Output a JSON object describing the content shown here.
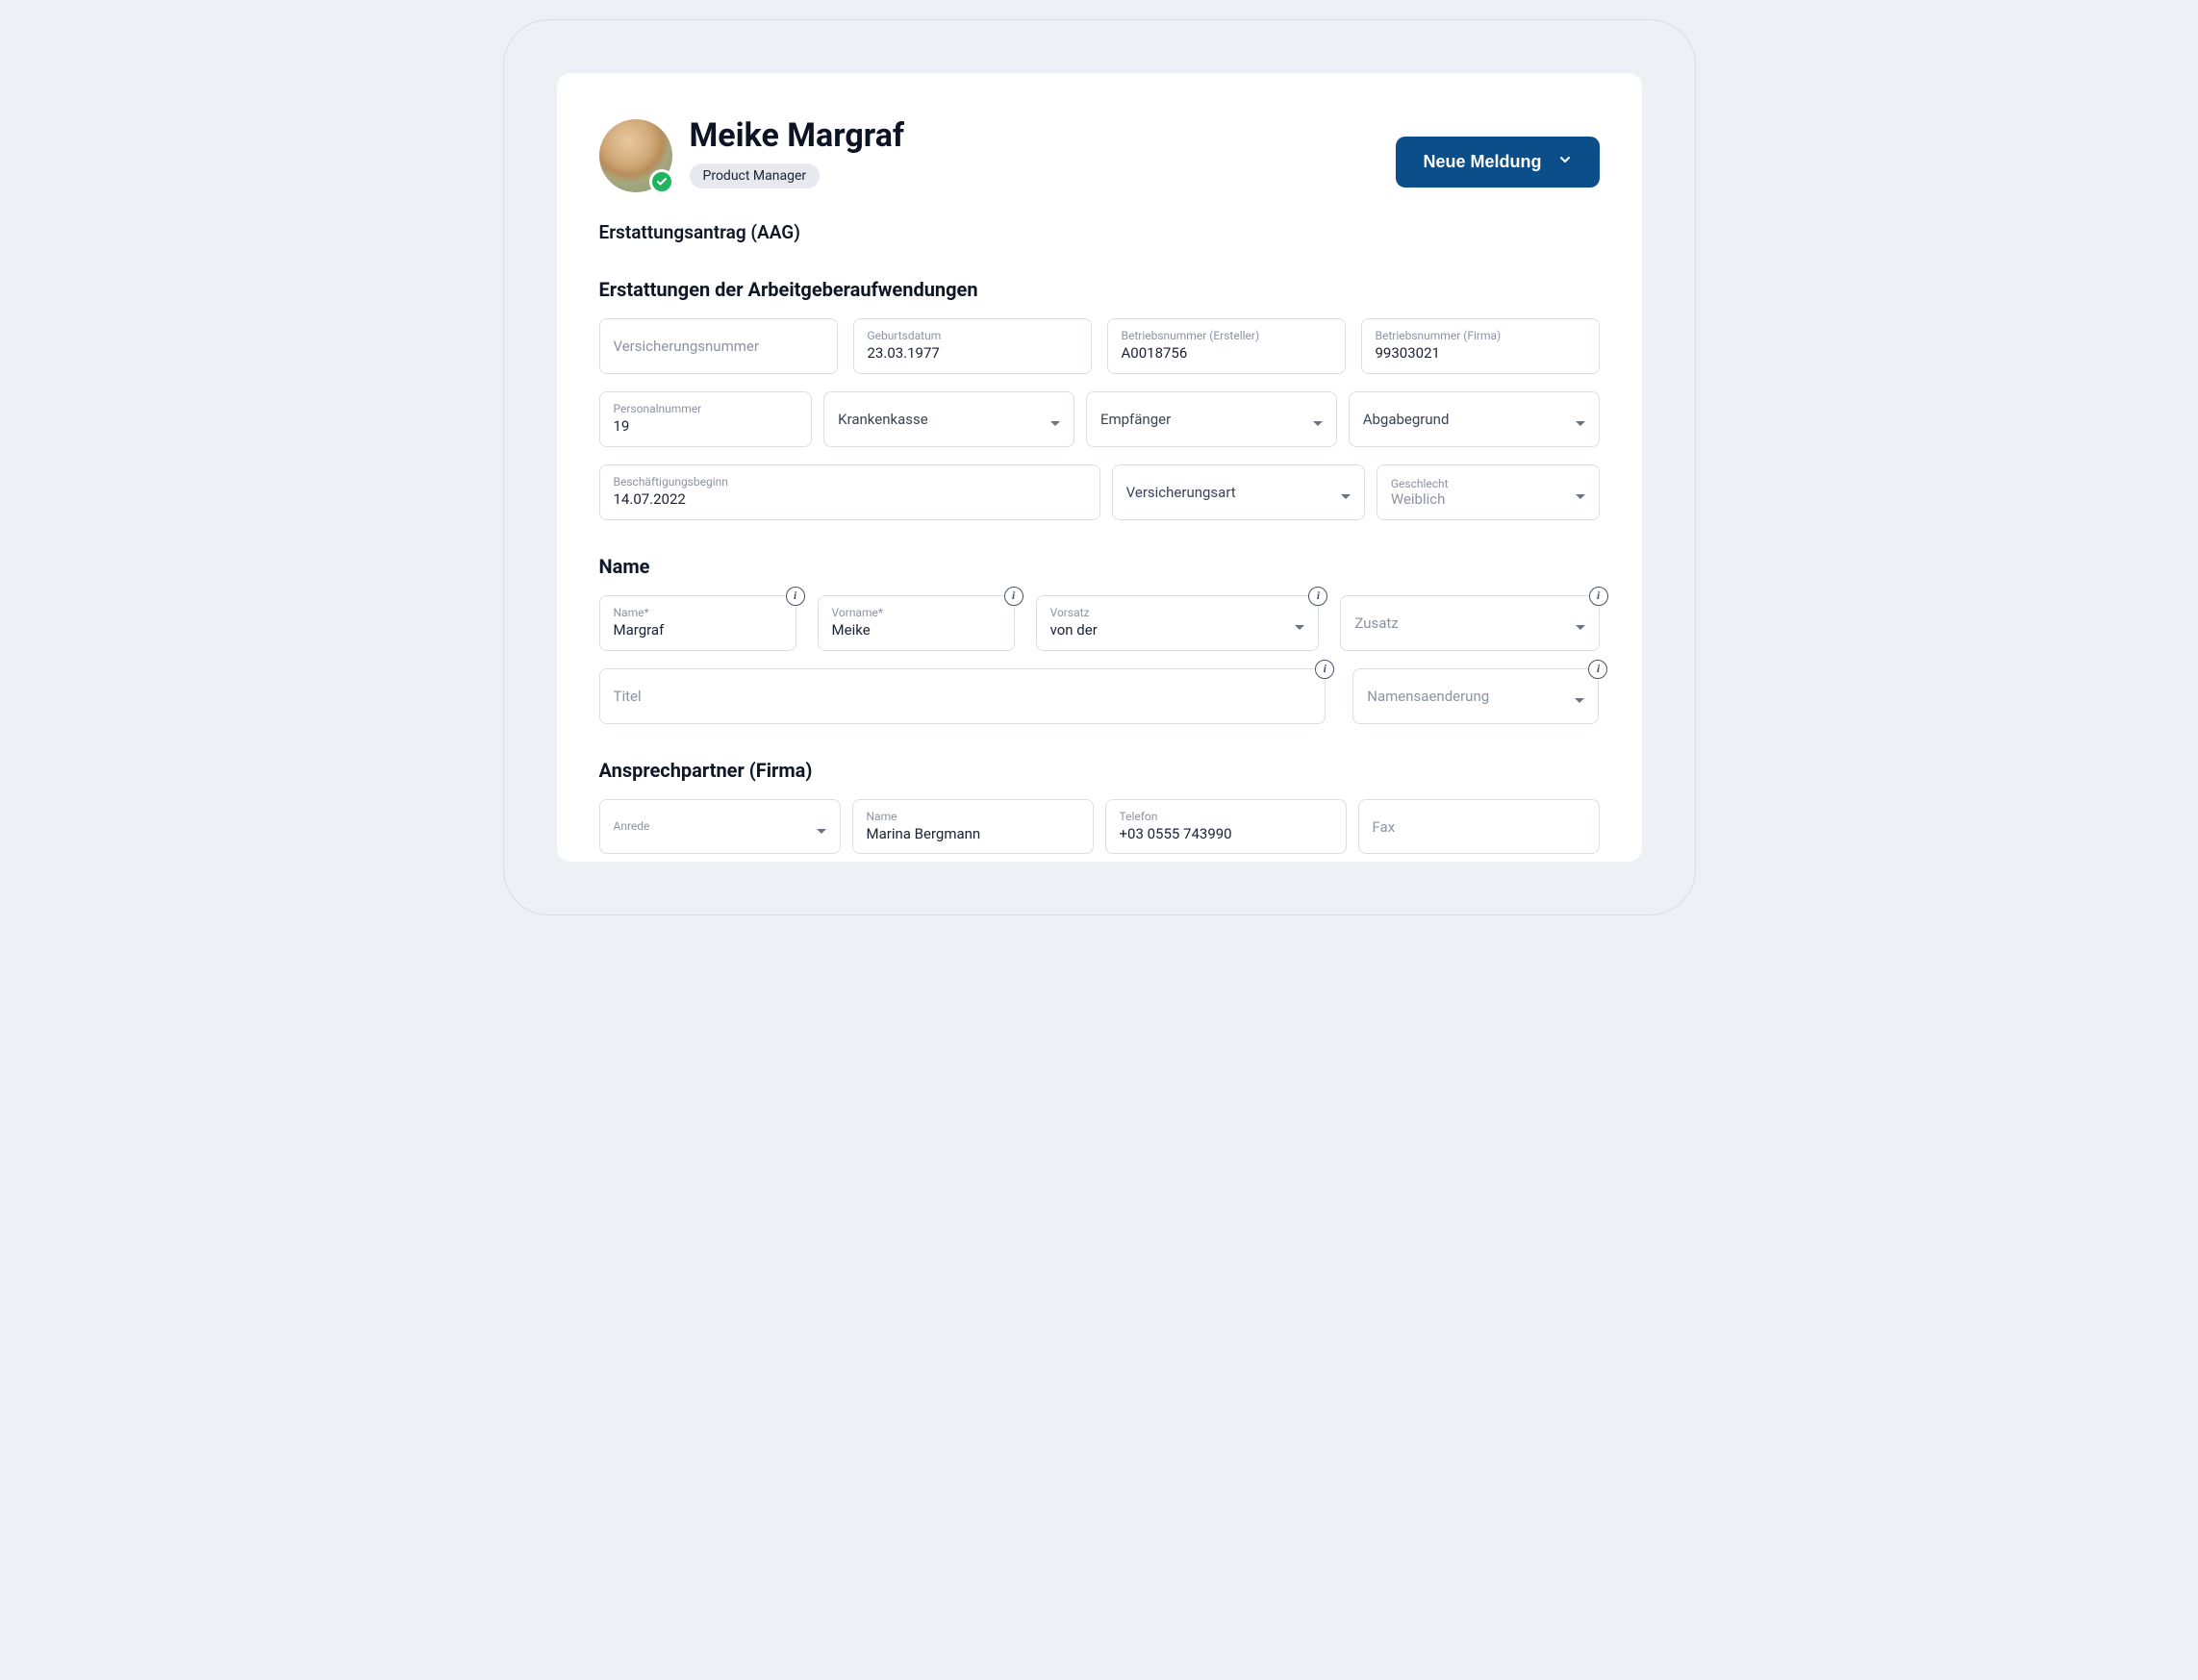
{
  "header": {
    "person_name": "Meike Margraf",
    "role": "Product Manager",
    "primary_button": "Neue Meldung"
  },
  "subtitle": "Erstattungsantrag (AAG)",
  "section1": {
    "heading": "Erstattungen der Arbeitgeberaufwendungen",
    "versicherungsnummer": {
      "placeholder": "Versicherungsnummer"
    },
    "geburtsdatum": {
      "label": "Geburtsdatum",
      "value": "23.03.1977"
    },
    "betriebsnummer_ersteller": {
      "label": "Betriebsnummer (Ersteller)",
      "value": "A0018756"
    },
    "betriebsnummer_firma": {
      "label": "Betriebsnummer (Firma)",
      "value": "99303021"
    },
    "personalnummer": {
      "label": "Personalnummer",
      "value": "19"
    },
    "krankenkasse": {
      "label": "Krankenkasse"
    },
    "empfaenger": {
      "label": "Empfänger"
    },
    "abgabegrund": {
      "label": "Abgabegrund"
    },
    "beschaeftigungsbeginn": {
      "label": "Beschäftigungsbeginn",
      "value": "14.07.2022"
    },
    "versicherungsart": {
      "label": "Versicherungsart"
    },
    "geschlecht": {
      "label": "Geschlecht",
      "value": "Weiblich"
    }
  },
  "section2": {
    "heading": "Name",
    "name": {
      "label": "Name*",
      "value": "Margraf"
    },
    "vorname": {
      "label": "Vorname*",
      "value": "Meike"
    },
    "vorsatz": {
      "label": "Vorsatz",
      "value": "von der"
    },
    "zusatz": {
      "label": "Zusatz"
    },
    "titel": {
      "placeholder": "Titel"
    },
    "namensaenderung": {
      "label": "Namensaenderung"
    }
  },
  "section3": {
    "heading": "Ansprechpartner (Firma)",
    "anrede": {
      "label": "Anrede"
    },
    "name": {
      "label": "Name",
      "value": "Marina Bergmann"
    },
    "telefon": {
      "label": "Telefon",
      "value": "+03 0555 743990"
    },
    "fax": {
      "placeholder": "Fax"
    }
  }
}
